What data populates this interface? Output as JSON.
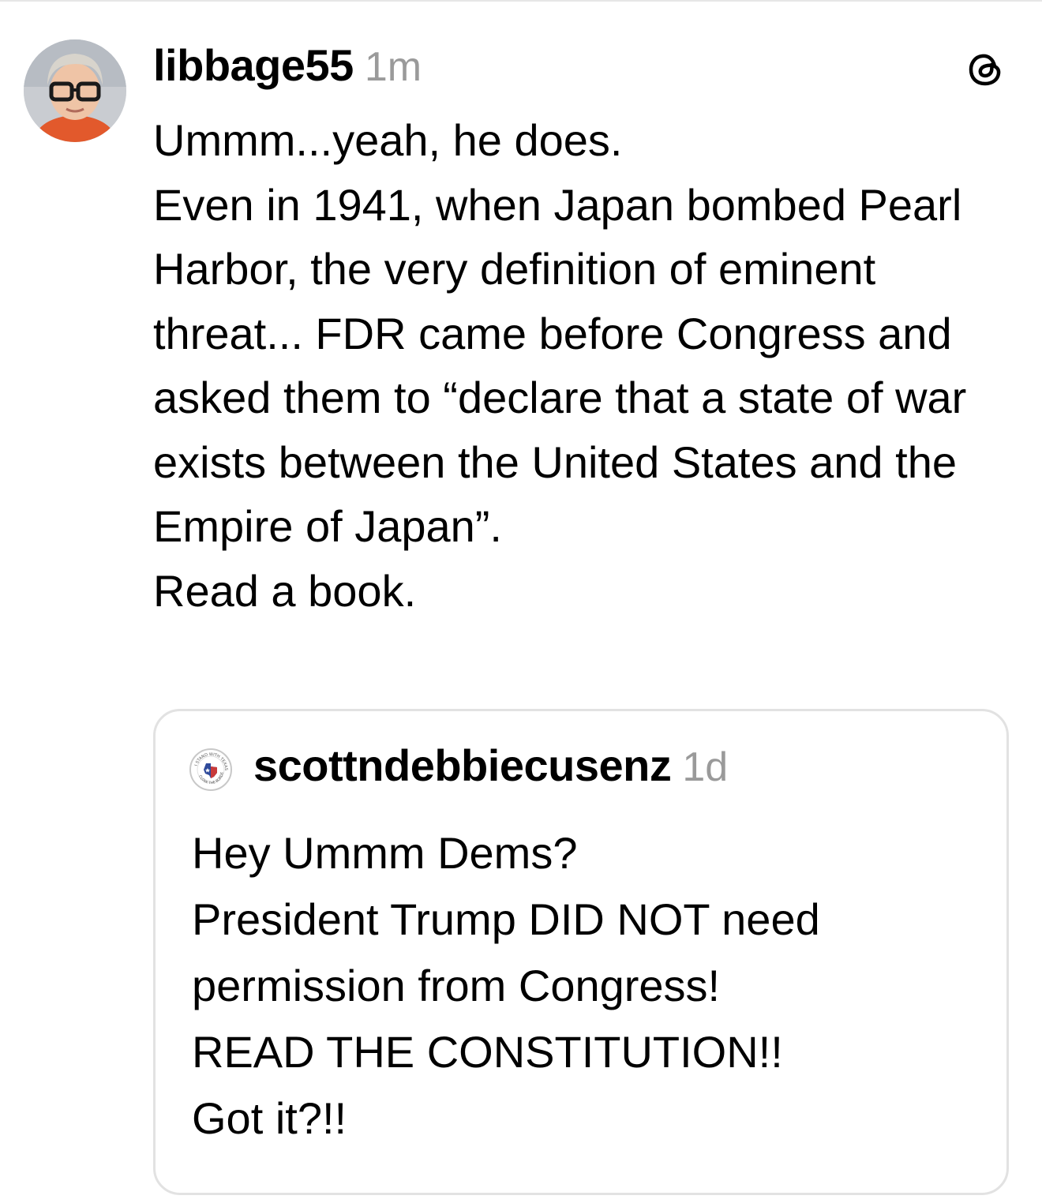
{
  "post": {
    "author": {
      "username": "libbage55",
      "timestamp": "1m",
      "avatar_icon": "user-avatar-photo"
    },
    "app_icon": "threads-logo-icon",
    "lines": [
      "Ummm...yeah, he does.",
      "Even in 1941, when Japan bombed Pearl Harbor, the very definition of eminent threat... FDR came before Congress and asked them to “declare that a state of war exists between the United States and the Empire of Japan”.",
      "Read a book."
    ],
    "quoted_post": {
      "author": {
        "username": "scottndebbiecusenz",
        "timestamp": "1d",
        "avatar_icon": "texas-badge-avatar",
        "avatar_text_top": "I STAND WITH TEXAS",
        "avatar_text_bottom": "CLOSE THE BORDER"
      },
      "lines": [
        "Hey Ummm Dems?",
        "President Trump DID NOT need permission from Congress!",
        "READ THE CONSTITUTION!!",
        "Got it?!!"
      ]
    }
  }
}
